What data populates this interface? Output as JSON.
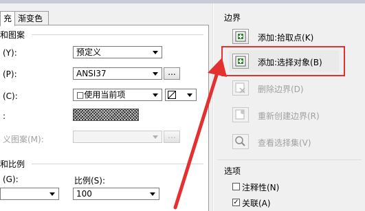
{
  "tabs": [
    {
      "label": "充"
    },
    {
      "label": "渐变色"
    }
  ],
  "left": {
    "section1": "和图案",
    "type_label": "(Y):",
    "type_value": "预定义",
    "pattern_label": "(P):",
    "pattern_value": "ANSI37",
    "color_label": "(C):",
    "color_value": "□使用当前项",
    "sample_label": ":",
    "custom_label": "义图案(M):",
    "dots": "...",
    "section2": "和比例",
    "angle_label": "(G):",
    "scale_label": "比例(S):",
    "scale_value": "100"
  },
  "right": {
    "group1": "边界",
    "btn_pick": "添加:拾取点(K)",
    "btn_select": "添加:选择对象(B)",
    "btn_remove": "删除边界(D)",
    "btn_recreate": "重新创建边界(R)",
    "btn_view": "查看选择集(V)",
    "group2": "选项",
    "chk_annotative": "注释性(N)",
    "chk_associative": "关联(A)"
  },
  "colors": {
    "accent_red": "#e53030",
    "icon_green": "#2e8b2e"
  }
}
